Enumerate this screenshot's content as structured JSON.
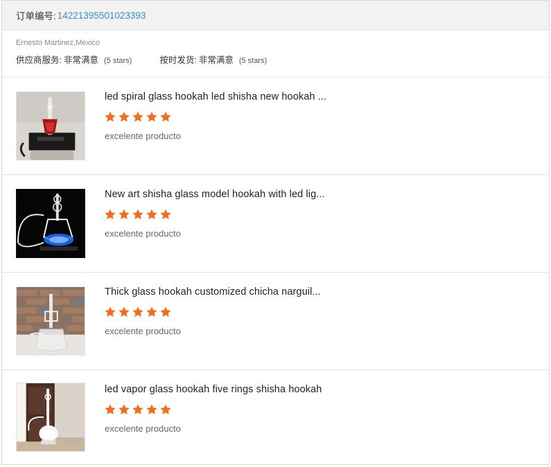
{
  "order": {
    "label": "订单编号:",
    "number": "14221395501023393"
  },
  "buyer": {
    "name": "Ernesto Martinez,Mexico",
    "ratings": [
      {
        "label": "供应商服务:",
        "value": "非常满意",
        "note": "(5 stars)"
      },
      {
        "label": "按时发货:",
        "value": "非常满意",
        "note": "(5 stars)"
      }
    ]
  },
  "accent_color": "#f26d1f",
  "reviews": [
    {
      "title": "led spiral glass hookah led shisha new hookah ...",
      "stars": 5,
      "comment": "excelente producto",
      "image": "hookah-on-black-box-photo"
    },
    {
      "title": "New art shisha glass model hookah with led lig...",
      "stars": 5,
      "comment": "excelente producto",
      "image": "glowing-blue-hookah-photo"
    },
    {
      "title": "Thick glass hookah customized chicha narguil...",
      "stars": 5,
      "comment": "excelente producto",
      "image": "glass-hookah-brick-wall-photo"
    },
    {
      "title": "led vapor glass hookah five rings shisha hookah",
      "stars": 5,
      "comment": "excelente producto",
      "image": "hookah-by-door-photo"
    }
  ]
}
